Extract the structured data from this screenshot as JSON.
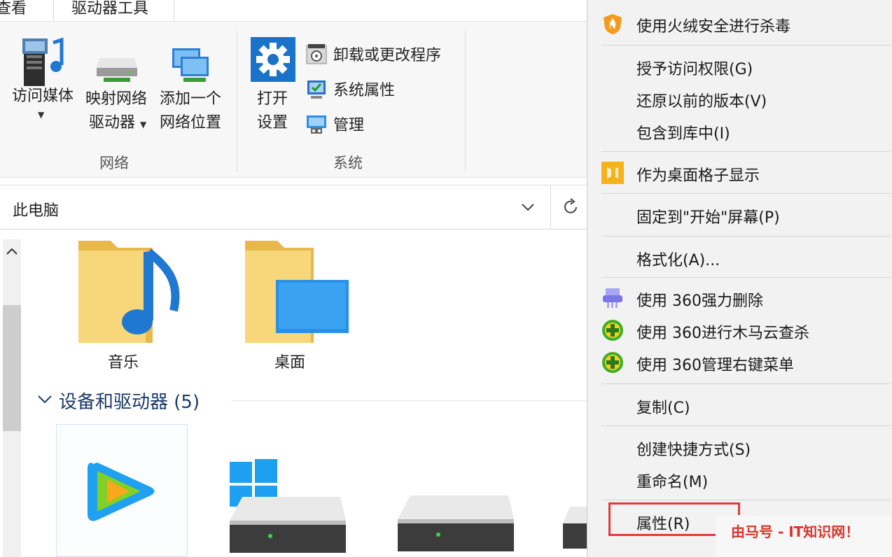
{
  "ribbon": {
    "tabs": [
      "查看",
      "驱动器工具"
    ],
    "network_group": {
      "label": "网络",
      "media": [
        "访问媒体"
      ],
      "map_drive": [
        "映射网络",
        "驱动器"
      ],
      "add_location": [
        "添加一个",
        "网络位置"
      ]
    },
    "system_group": {
      "label": "系统",
      "open_settings": [
        "打开",
        "设置"
      ],
      "uninstall": "卸载或更改程序",
      "system_properties": "系统属性",
      "manage": "管理"
    }
  },
  "address_bar": {
    "path": "此电脑"
  },
  "content": {
    "folders": [
      {
        "label": "音乐"
      },
      {
        "label": "桌面"
      }
    ],
    "section_title": "设备和驱动器 (5)"
  },
  "context_menu": {
    "items": [
      {
        "label": "使用火绒安全进行杀毒",
        "icon": "huorong-shield-icon"
      },
      {
        "label": "授予访问权限(G)"
      },
      {
        "label": "还原以前的版本(V)"
      },
      {
        "label": "包含到库中(I)"
      },
      {
        "label": "作为桌面格子显示",
        "icon": "desktop-grid-icon"
      },
      {
        "label": "固定到\"开始\"屏幕(P)"
      },
      {
        "label": "格式化(A)..."
      },
      {
        "label": "使用 360强力删除",
        "icon": "360-shredder-icon"
      },
      {
        "label": "使用 360进行木马云查杀",
        "icon": "360-plus-icon"
      },
      {
        "label": "使用 360管理右键菜单",
        "icon": "360-plus-icon"
      },
      {
        "label": "复制(C)"
      },
      {
        "label": "创建快捷方式(S)"
      },
      {
        "label": "重命名(M)"
      },
      {
        "label": "属性(R)"
      }
    ]
  },
  "watermark": "由马号 - IT知识网！",
  "colors": {
    "highlight_border": "#e03a3a",
    "folder": "#f4cf6b",
    "music_note": "#1f78d1",
    "monitor": "#2b8fe6"
  }
}
